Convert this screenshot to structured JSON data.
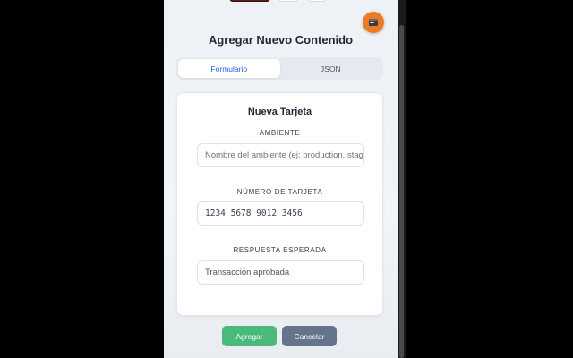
{
  "header": {
    "title": "Agregar Nuevo Contenido",
    "fab_icon": "terminal-icon",
    "fab_color": "#ef7a26"
  },
  "tabs": [
    {
      "label": "Formulario",
      "active": true
    },
    {
      "label": "JSON",
      "active": false
    }
  ],
  "card": {
    "title": "Nueva Tarjeta",
    "fields": [
      {
        "label": "AMBIENTE",
        "value": "",
        "placeholder": "Nombre del ambiente (ej: production, staging)"
      },
      {
        "label": "NÚMERO DE TARJETA",
        "value": "1234 5678 9012 3456",
        "placeholder": ""
      },
      {
        "label": "RESPUESTA ESPERADA",
        "value": "Transacción aprobada",
        "placeholder": ""
      }
    ]
  },
  "actions": {
    "add_label": "Agregar",
    "cancel_label": "Cancelar"
  },
  "colors": {
    "accent": "#2563eb",
    "add_button": "#4bb87c",
    "cancel_button": "#64748b"
  }
}
